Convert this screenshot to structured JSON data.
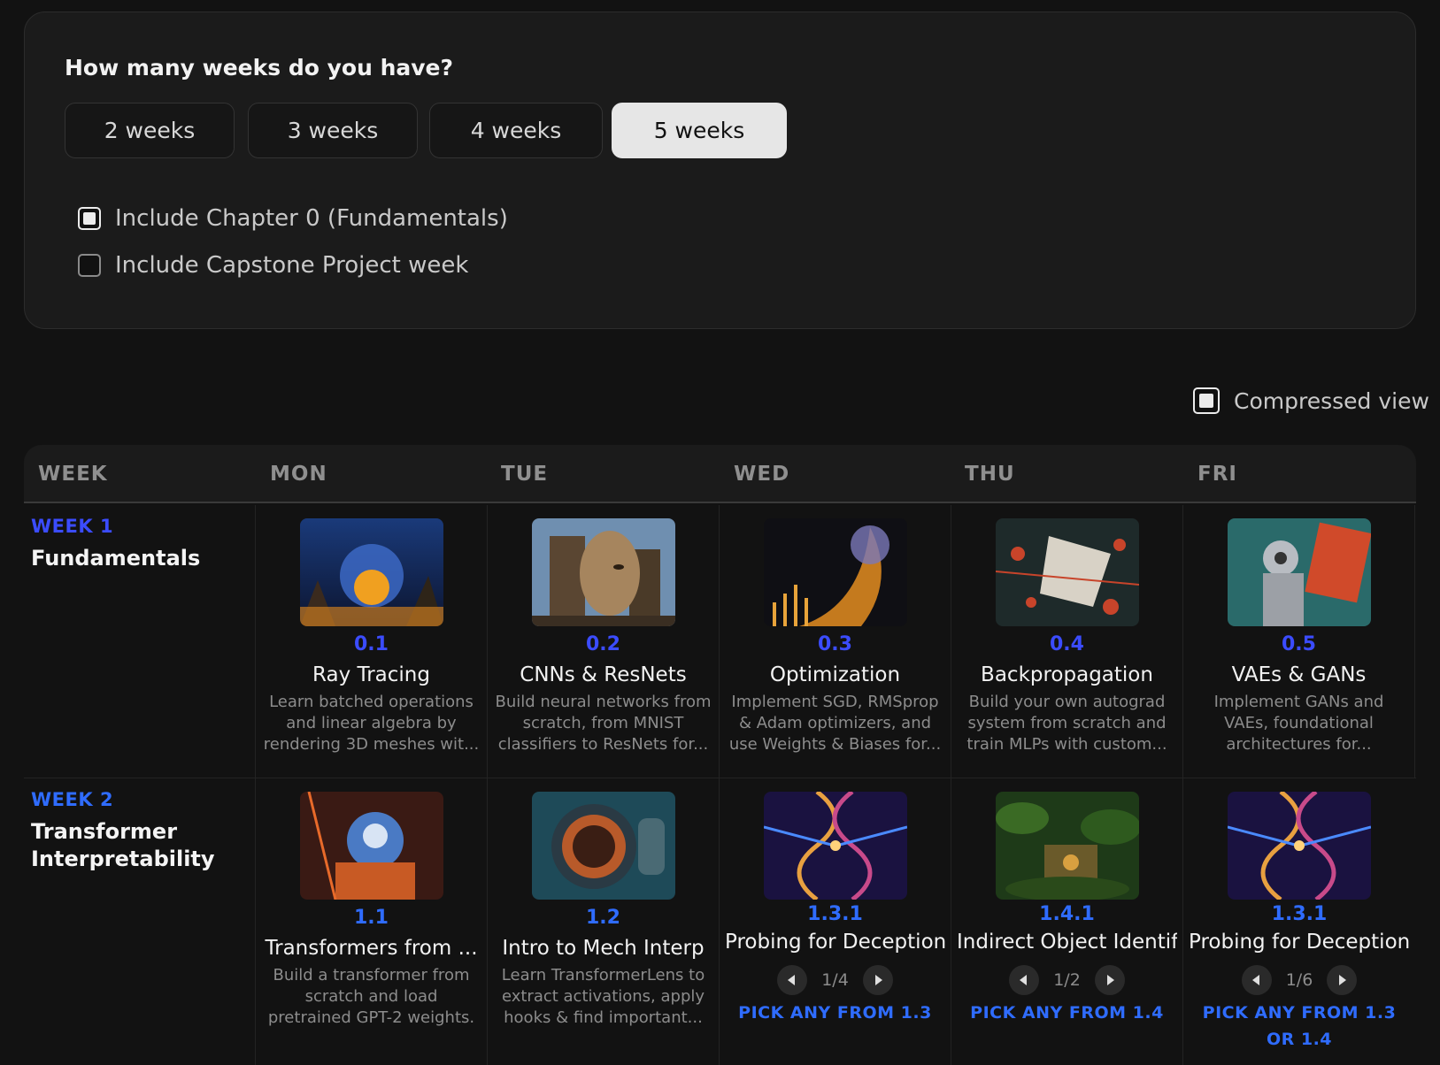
{
  "planner": {
    "question": "How many weeks do you have?",
    "week_options": [
      "2 weeks",
      "3 weeks",
      "4 weeks",
      "5 weeks"
    ],
    "selected_option": "5 weeks",
    "include_chapter0_label": "Include Chapter 0 (Fundamentals)",
    "include_chapter0_checked": true,
    "include_capstone_label": "Include Capstone Project week",
    "include_capstone_checked": false
  },
  "compressed_view": {
    "label": "Compressed view",
    "checked": true
  },
  "table": {
    "headers": [
      "WEEK",
      "MON",
      "TUE",
      "WED",
      "THU",
      "FRI"
    ],
    "weeks": [
      {
        "number": "WEEK 1",
        "name": "Fundamentals",
        "days": [
          {
            "code": "0.1",
            "title": "Ray Tracing",
            "desc": "Learn batched operations and linear algebra by rendering 3D meshes wit..."
          },
          {
            "code": "0.2",
            "title": "CNNs & ResNets",
            "desc": "Build neural networks from scratch, from MNIST classifiers to ResNets for..."
          },
          {
            "code": "0.3",
            "title": "Optimization",
            "desc": "Implement SGD, RMSprop & Adam optimizers, and use Weights & Biases for..."
          },
          {
            "code": "0.4",
            "title": "Backpropagation",
            "desc": "Build your own autograd system from scratch and train MLPs with custom..."
          },
          {
            "code": "0.5",
            "title": "VAEs & GANs",
            "desc": "Implement GANs and VAEs, foundational architectures for..."
          }
        ]
      },
      {
        "number": "WEEK 2",
        "name": "Transformer Interpretability",
        "days": [
          {
            "code": "1.1",
            "title": "Transformers from ...",
            "desc": "Build a transformer from scratch and load pretrained GPT-2 weights."
          },
          {
            "code": "1.2",
            "title": "Intro to Mech Interp",
            "desc": "Learn TransformerLens to extract activations, apply hooks & find important..."
          },
          {
            "code": "1.3.1",
            "title": "Probing for Deception",
            "pager": "1/4",
            "pick": "PICK ANY FROM 1.3"
          },
          {
            "code": "1.4.1",
            "title": "Indirect Object Identifi...",
            "pager": "1/2",
            "pick": "PICK ANY FROM 1.4"
          },
          {
            "code": "1.3.1",
            "title": "Probing for Deception",
            "pager": "1/6",
            "pick": "PICK ANY FROM 1.3 OR 1.4"
          }
        ]
      }
    ]
  },
  "colors": {
    "accent_indigo": "#3b4cff",
    "accent_blue": "#2f6cff",
    "background": "#121212",
    "panel": "#1b1b1b"
  }
}
